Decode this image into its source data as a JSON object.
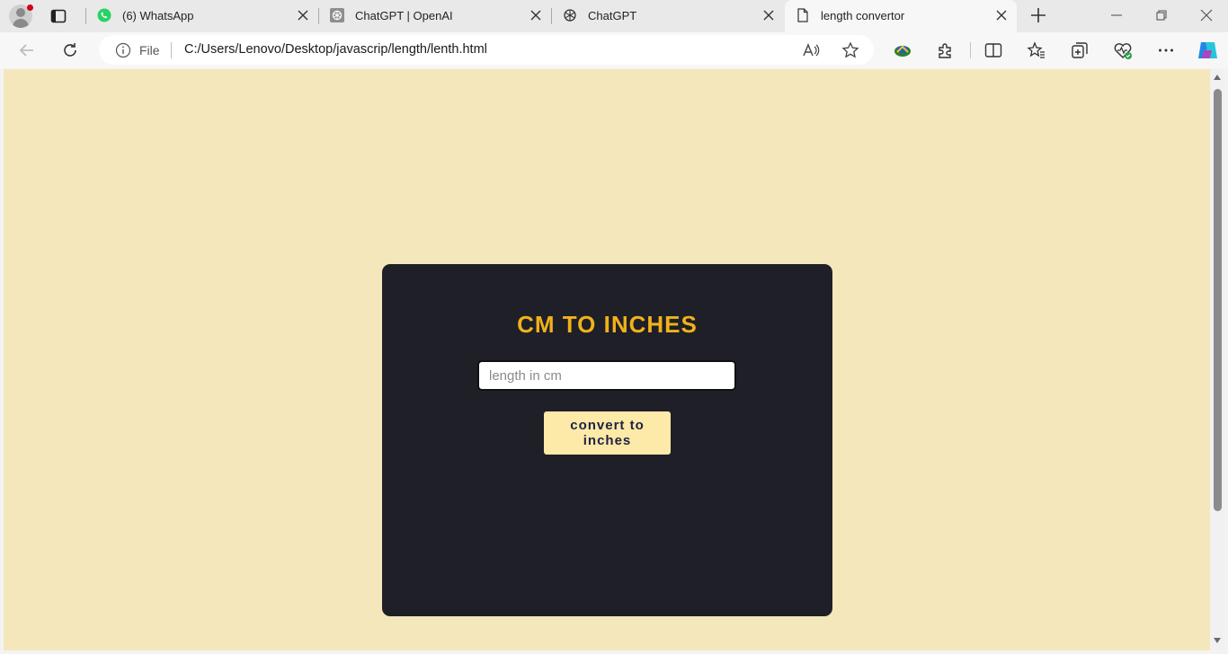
{
  "browser": {
    "tabs": [
      {
        "title": "(6) WhatsApp",
        "icon": "whatsapp-icon"
      },
      {
        "title": "ChatGPT | OpenAI",
        "icon": "openai-icon"
      },
      {
        "title": "ChatGPT",
        "icon": "openai-icon"
      },
      {
        "title": "length convertor",
        "icon": "document-icon",
        "active": true
      }
    ],
    "address": {
      "scheme_label": "File",
      "url": "C:/Users/Lenovo/Desktop/javascrip/length/lenth.html"
    }
  },
  "page": {
    "background_color": "#f4e7bb",
    "card_color": "#1f1f28",
    "heading": "CM TO INCHES",
    "heading_color": "#f0b21a",
    "input_value": "",
    "input_placeholder": "length in cm",
    "button_label": "convert to inches",
    "button_color": "#fde9a8",
    "result": ""
  }
}
